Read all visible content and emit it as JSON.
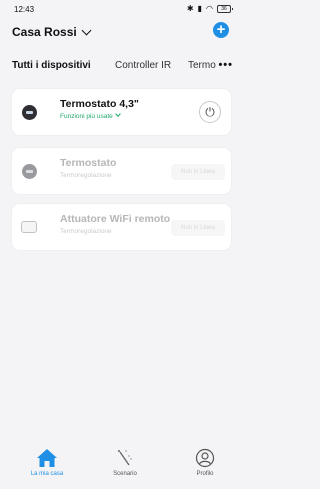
{
  "status_bar": {
    "time": "12:43",
    "battery": "36"
  },
  "header": {
    "home_name": "Casa Rossi"
  },
  "tabs": [
    {
      "label": "Tutti i dispositivi",
      "active": true
    },
    {
      "label": "Controller IR",
      "active": false
    },
    {
      "label": "Termo",
      "active": false
    }
  ],
  "tabs_more": "•••",
  "devices": [
    {
      "name": "Termostato 4,3\"",
      "subtitle": "Funzioni più usate",
      "state": "online",
      "icon": "thermostat-icon"
    },
    {
      "name": "Termostato",
      "subtitle": "Termoregolazione",
      "state": "offline",
      "badge": "Non in Linea",
      "icon": "thermostat-icon"
    },
    {
      "name": "Attuatore WiFi remoto",
      "subtitle": "Termoregolazione",
      "state": "offline",
      "badge": "Non in Linea",
      "icon": "actuator-icon"
    }
  ],
  "bottom_nav": [
    {
      "label": "La mia casa",
      "icon": "home-icon",
      "active": true
    },
    {
      "label": "Scenario",
      "icon": "scene-wand-icon",
      "active": false
    },
    {
      "label": "Profilo",
      "icon": "profile-icon",
      "active": false
    }
  ],
  "colors": {
    "accent": "#1f8fe6",
    "online_green": "#21a96b",
    "background": "#f4f4f6"
  }
}
